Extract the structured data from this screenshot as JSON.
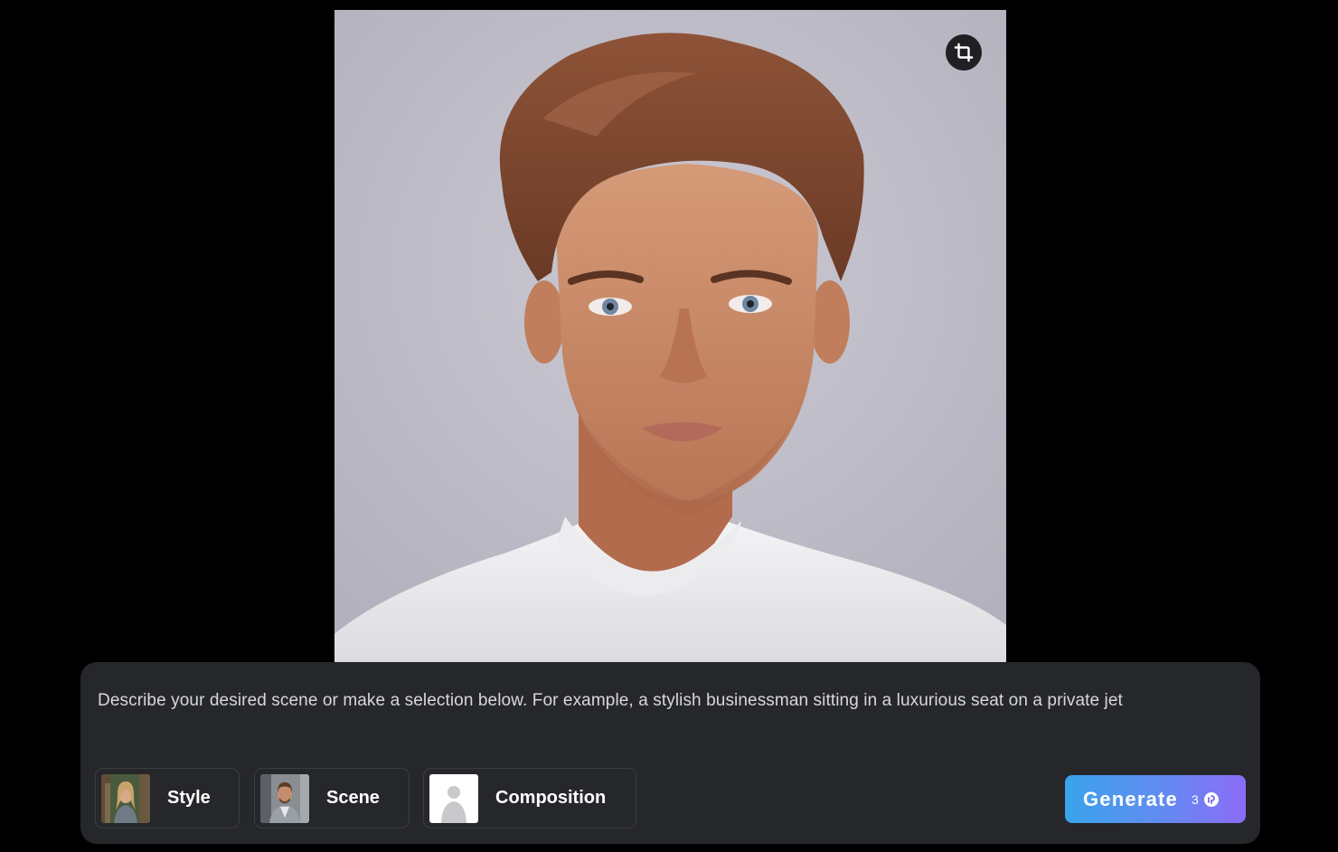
{
  "photo": {
    "alt": "",
    "crop_icon": "crop-icon"
  },
  "prompt": {
    "placeholder": "Describe your desired scene or make a selection below. For example, a stylish businessman sitting in a luxurious seat on a private jet"
  },
  "options": {
    "style_label": "Style",
    "scene_label": "Scene",
    "composition_label": "Composition"
  },
  "generate": {
    "label": "Generate",
    "credits": "3",
    "credit_icon": "credit-coin-icon"
  },
  "colors": {
    "panel_bg": "#26272b",
    "generate_gradient_start": "#3aa3ec",
    "generate_gradient_end": "#8b6cf7"
  }
}
